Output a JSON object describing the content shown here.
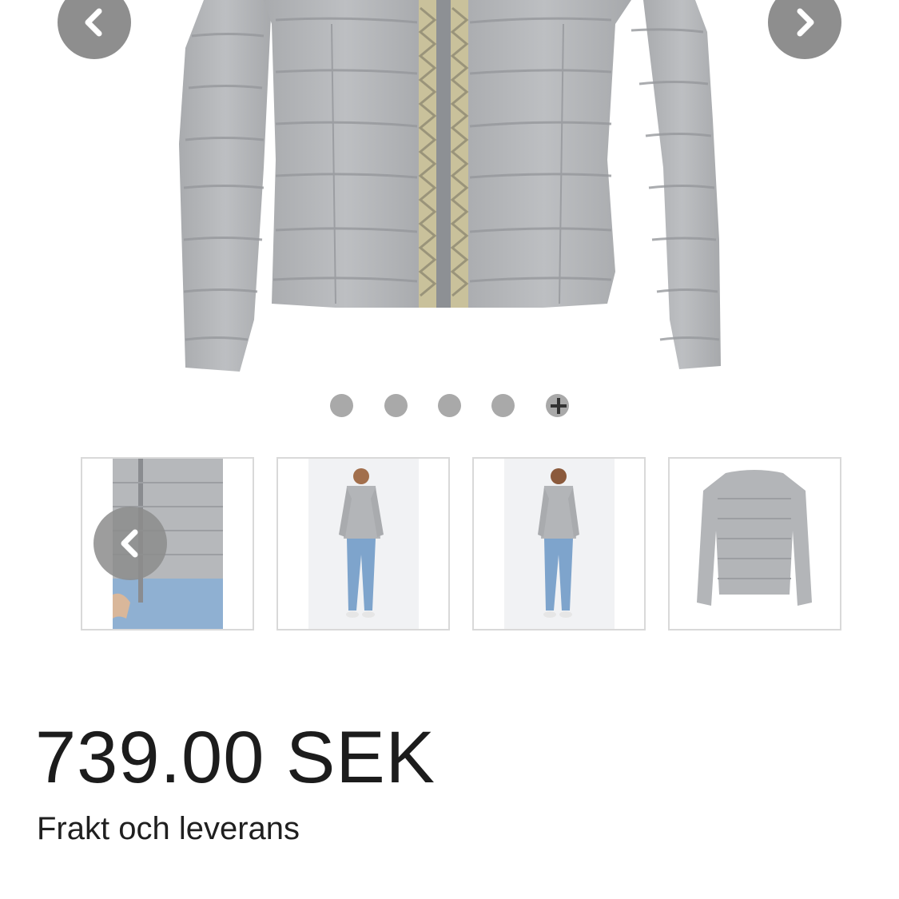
{
  "gallery": {
    "main_image_alt": "",
    "prev_icon": "chevron-left-icon",
    "next_icon": "chevron-right-icon",
    "slide_count": 5,
    "active_slide": 5,
    "dot_color": "#a9a9a9",
    "arrow_color": "#8e8e8e"
  },
  "thumbnails": [
    {
      "name": "jacket-detail-closeup"
    },
    {
      "name": "model-front"
    },
    {
      "name": "model-back"
    },
    {
      "name": "jacket-flat-back"
    }
  ],
  "product": {
    "price": "739.00 SEK",
    "shipping_link": "Frakt och leverans"
  },
  "colors": {
    "jacket": "#b3b5b8",
    "text": "#1c1c1c"
  }
}
